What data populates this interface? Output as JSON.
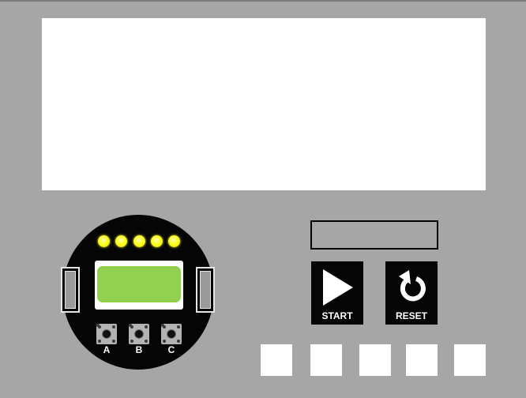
{
  "controls": {
    "start_label": "START",
    "reset_label": "RESET"
  },
  "device": {
    "led_color": "#ffff22",
    "screen_color": "#92d050",
    "buttons": [
      {
        "label": "A"
      },
      {
        "label": "B"
      },
      {
        "label": "C"
      }
    ]
  },
  "readout": {
    "value": ""
  },
  "icons": {
    "start": "play-icon",
    "reset": "reset-icon"
  }
}
